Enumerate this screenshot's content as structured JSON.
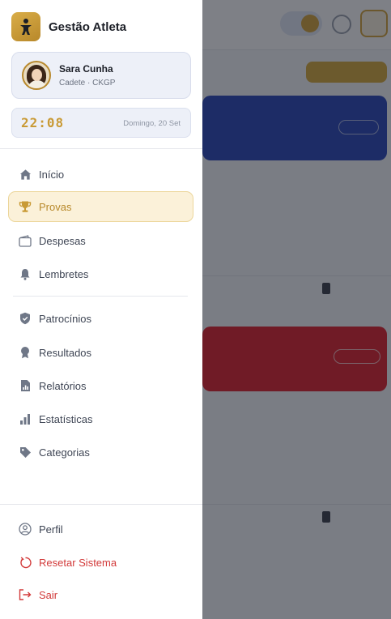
{
  "app": {
    "title": "Gestão Atleta"
  },
  "profile": {
    "name": "Sara Cunha",
    "subtitle": "Cadete · CKGP"
  },
  "clock": {
    "time": "22:08",
    "date": "Domingo, 20 Set"
  },
  "nav": {
    "primary": [
      {
        "label": "Início",
        "icon": "home-icon"
      },
      {
        "label": "Provas",
        "icon": "trophy-icon",
        "active": true
      },
      {
        "label": "Despesas",
        "icon": "wallet-icon"
      },
      {
        "label": "Lembretes",
        "icon": "bell-icon"
      }
    ],
    "secondary": [
      {
        "label": "Patrocínios",
        "icon": "shield-icon"
      },
      {
        "label": "Resultados",
        "icon": "medal-icon"
      },
      {
        "label": "Relatórios",
        "icon": "report-icon"
      },
      {
        "label": "Estatísticas",
        "icon": "bar-chart-icon"
      },
      {
        "label": "Categorias",
        "icon": "tag-icon"
      }
    ],
    "footer": [
      {
        "label": "Perfil",
        "icon": "user-circle-icon"
      },
      {
        "label": "Resetar Sistema",
        "icon": "reset-icon"
      },
      {
        "label": "Sair",
        "icon": "logout-icon"
      }
    ]
  },
  "colors": {
    "accent": "#c99a35",
    "active_bg": "#fbf1d9",
    "danger": "#d23a3a",
    "overlay": "#141822"
  }
}
